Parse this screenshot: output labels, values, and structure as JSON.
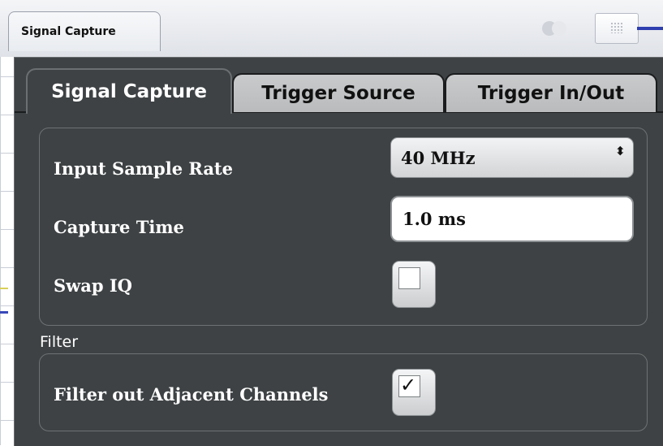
{
  "window": {
    "title": "Signal Capture"
  },
  "tabs": [
    {
      "label": "Signal Capture",
      "active": true
    },
    {
      "label": "Trigger Source",
      "active": false
    },
    {
      "label": "Trigger In/Out",
      "active": false
    }
  ],
  "capture": {
    "input_sample_rate_label": "Input Sample Rate",
    "input_sample_rate_value": "40 MHz",
    "select_arrows": "⬍",
    "capture_time_label": "Capture Time",
    "capture_time_value": "1.0 ms",
    "swap_iq_label": "Swap IQ",
    "swap_iq_checked": false
  },
  "filter": {
    "section_label": "Filter",
    "adjacent_channels_label": "Filter out Adjacent Channels",
    "adjacent_channels_checked": true,
    "check_mark": "✓"
  },
  "colors": {
    "dialog_background": "#3e4244",
    "inactive_tab": "#c0c2c4",
    "accent_line": "#2f3fb0"
  }
}
